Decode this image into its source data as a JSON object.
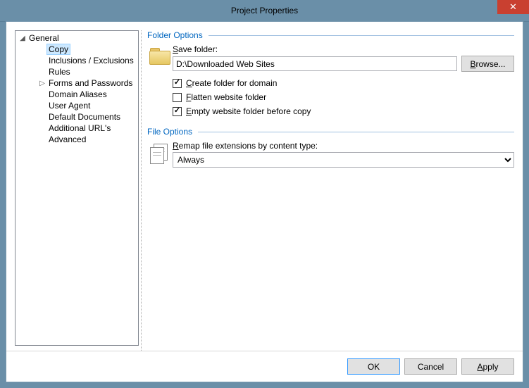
{
  "window": {
    "title": "Project Properties",
    "close_symbol": "✕"
  },
  "nav": {
    "root": "General",
    "items": {
      "copy": "Copy",
      "inclusions": "Inclusions / Exclusions",
      "rules": "Rules",
      "forms": "Forms and Passwords",
      "domain_aliases": "Domain Aliases",
      "user_agent": "User Agent",
      "default_docs": "Default Documents",
      "additional_urls": "Additional URL's",
      "advanced": "Advanced"
    }
  },
  "folder_options": {
    "legend": "Folder Options",
    "save_folder_label": "Save folder:",
    "save_folder_value": "D:\\Downloaded Web Sites",
    "browse_label": "Browse...",
    "create_folder_label": "Create folder for domain",
    "create_folder_checked": true,
    "flatten_label": "Flatten website folder",
    "flatten_checked": false,
    "empty_label": "Empty website folder before copy",
    "empty_checked": true
  },
  "file_options": {
    "legend": "File Options",
    "remap_label": "Remap file extensions by content type:",
    "remap_value": "Always"
  },
  "buttons": {
    "ok": "OK",
    "cancel": "Cancel",
    "apply": "Apply"
  }
}
